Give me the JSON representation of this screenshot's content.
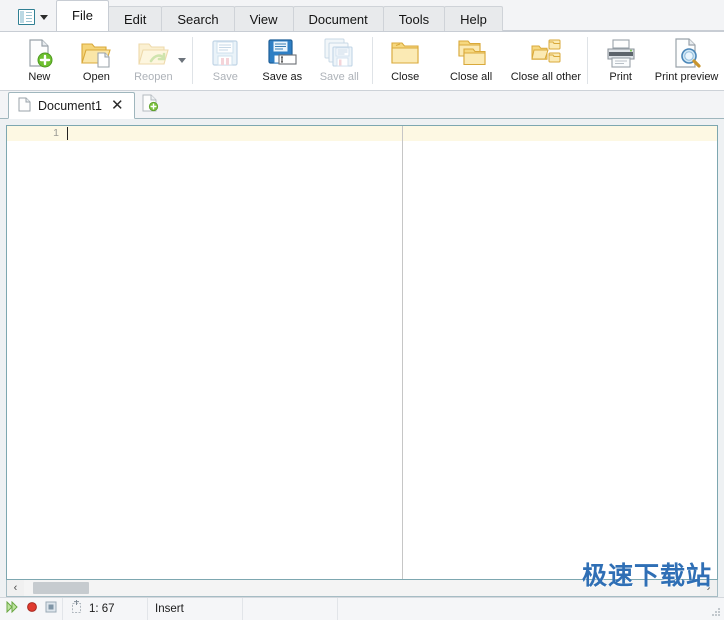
{
  "menubar": {
    "quick_access_icon": "document-list-icon",
    "quick_access_caret": "chevron-down-icon",
    "tabs": [
      {
        "label": "File",
        "active": true
      },
      {
        "label": "Edit",
        "active": false
      },
      {
        "label": "Search",
        "active": false
      },
      {
        "label": "View",
        "active": false
      },
      {
        "label": "Document",
        "active": false
      },
      {
        "label": "Tools",
        "active": false
      },
      {
        "label": "Help",
        "active": false
      }
    ]
  },
  "ribbon": {
    "buttons": [
      {
        "label": "New",
        "icon": "new-document-icon",
        "disabled": false
      },
      {
        "label": "Open",
        "icon": "open-folder-icon",
        "disabled": false
      },
      {
        "label": "Reopen",
        "icon": "reopen-folder-icon",
        "disabled": true,
        "caret": "chevron-down-icon"
      },
      {
        "label": "Save",
        "icon": "save-floppy-icon",
        "disabled": true
      },
      {
        "label": "Save as",
        "icon": "save-as-floppy-icon",
        "disabled": false
      },
      {
        "label": "Save all",
        "icon": "save-all-floppy-icon",
        "disabled": true
      },
      {
        "label": "Close",
        "icon": "close-folder-icon",
        "disabled": false
      },
      {
        "label": "Close all",
        "icon": "close-all-folders-icon",
        "disabled": false
      },
      {
        "label": "Close all other",
        "icon": "close-all-other-folders-icon",
        "disabled": false
      },
      {
        "label": "Print",
        "icon": "printer-icon",
        "disabled": false
      },
      {
        "label": "Print preview",
        "icon": "print-preview-icon",
        "disabled": false
      }
    ]
  },
  "tabbar": {
    "documents": [
      {
        "label": "Document1",
        "icon": "document-icon",
        "close": "✕",
        "active": true
      }
    ],
    "new_tab_icon": "new-document-plus-icon"
  },
  "editor": {
    "line_numbers": [
      "1"
    ],
    "content": "",
    "margin_guide": true
  },
  "hscroll": {
    "left_arrow": "‹",
    "right_arrow": "›"
  },
  "statusbar": {
    "run_icon": "play-icon",
    "record_icon": "record-icon",
    "stop_icon": "stop-icon",
    "caret_icon": "caret-position-icon",
    "position": "1: 67",
    "mode": "Insert",
    "cell4": "",
    "cell5": ""
  },
  "watermark": {
    "text": "极速下载站"
  },
  "colors": {
    "accent": "#2f7f93",
    "tab_border": "#9fb6bd",
    "current_line": "#fdf8e3",
    "watermark": "#2f6fb5",
    "folder": "#f0c14b"
  }
}
